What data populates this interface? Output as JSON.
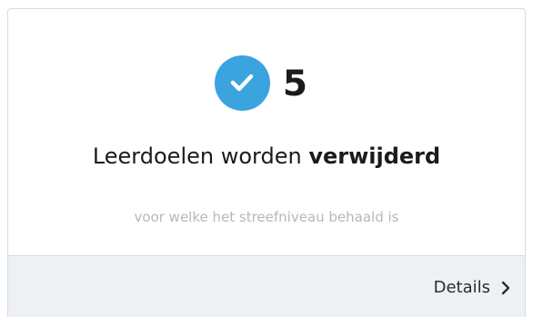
{
  "card": {
    "count": "5",
    "headline_prefix": "Leerdoelen worden ",
    "headline_emphasis": "verwijderd",
    "subtext": "voor welke het streefniveau behaald is",
    "details_label": "Details",
    "check_icon": "check-icon",
    "chevron_icon": "chevron-right-icon",
    "accent_color": "#3ba3de",
    "footer_color": "#eef1f4"
  }
}
